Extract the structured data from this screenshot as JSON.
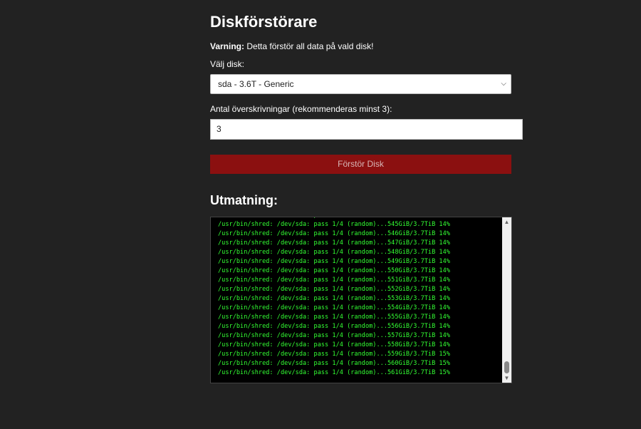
{
  "page": {
    "title": "Diskförstörare",
    "warning_label": "Varning:",
    "warning_text": " Detta förstör all data på vald disk!"
  },
  "form": {
    "disk_label": "Välj disk:",
    "disk_selected": "sda - 3.6T - Generic",
    "passes_label": "Antal överskrivningar (rekommenderas minst 3):",
    "passes_value": "3",
    "destroy_button": "Förstör Disk"
  },
  "output": {
    "heading": "Utmatning:",
    "lines": [
      "/usr/bin/shred: /dev/sda: pass 1/4 (random)...544GiB/3.7TiB 14%",
      "/usr/bin/shred: /dev/sda: pass 1/4 (random)...545GiB/3.7TiB 14%",
      "/usr/bin/shred: /dev/sda: pass 1/4 (random)...546GiB/3.7TiB 14%",
      "/usr/bin/shred: /dev/sda: pass 1/4 (random)...547GiB/3.7TiB 14%",
      "/usr/bin/shred: /dev/sda: pass 1/4 (random)...548GiB/3.7TiB 14%",
      "/usr/bin/shred: /dev/sda: pass 1/4 (random)...549GiB/3.7TiB 14%",
      "/usr/bin/shred: /dev/sda: pass 1/4 (random)...550GiB/3.7TiB 14%",
      "/usr/bin/shred: /dev/sda: pass 1/4 (random)...551GiB/3.7TiB 14%",
      "/usr/bin/shred: /dev/sda: pass 1/4 (random)...552GiB/3.7TiB 14%",
      "/usr/bin/shred: /dev/sda: pass 1/4 (random)...553GiB/3.7TiB 14%",
      "/usr/bin/shred: /dev/sda: pass 1/4 (random)...554GiB/3.7TiB 14%",
      "/usr/bin/shred: /dev/sda: pass 1/4 (random)...555GiB/3.7TiB 14%",
      "/usr/bin/shred: /dev/sda: pass 1/4 (random)...556GiB/3.7TiB 14%",
      "/usr/bin/shred: /dev/sda: pass 1/4 (random)...557GiB/3.7TiB 14%",
      "/usr/bin/shred: /dev/sda: pass 1/4 (random)...558GiB/3.7TiB 14%",
      "/usr/bin/shred: /dev/sda: pass 1/4 (random)...559GiB/3.7TiB 15%",
      "/usr/bin/shred: /dev/sda: pass 1/4 (random)...560GiB/3.7TiB 15%",
      "/usr/bin/shred: /dev/sda: pass 1/4 (random)...561GiB/3.7TiB 15%"
    ]
  },
  "icons": {
    "select_chevron": "chevron-down-icon",
    "scroll_up": "triangle-up-icon",
    "scroll_down": "triangle-down-icon"
  },
  "colors": {
    "background": "#222222",
    "destroy_button": "#8b1010",
    "terminal_text": "#33ff33",
    "terminal_bg": "#000000"
  }
}
